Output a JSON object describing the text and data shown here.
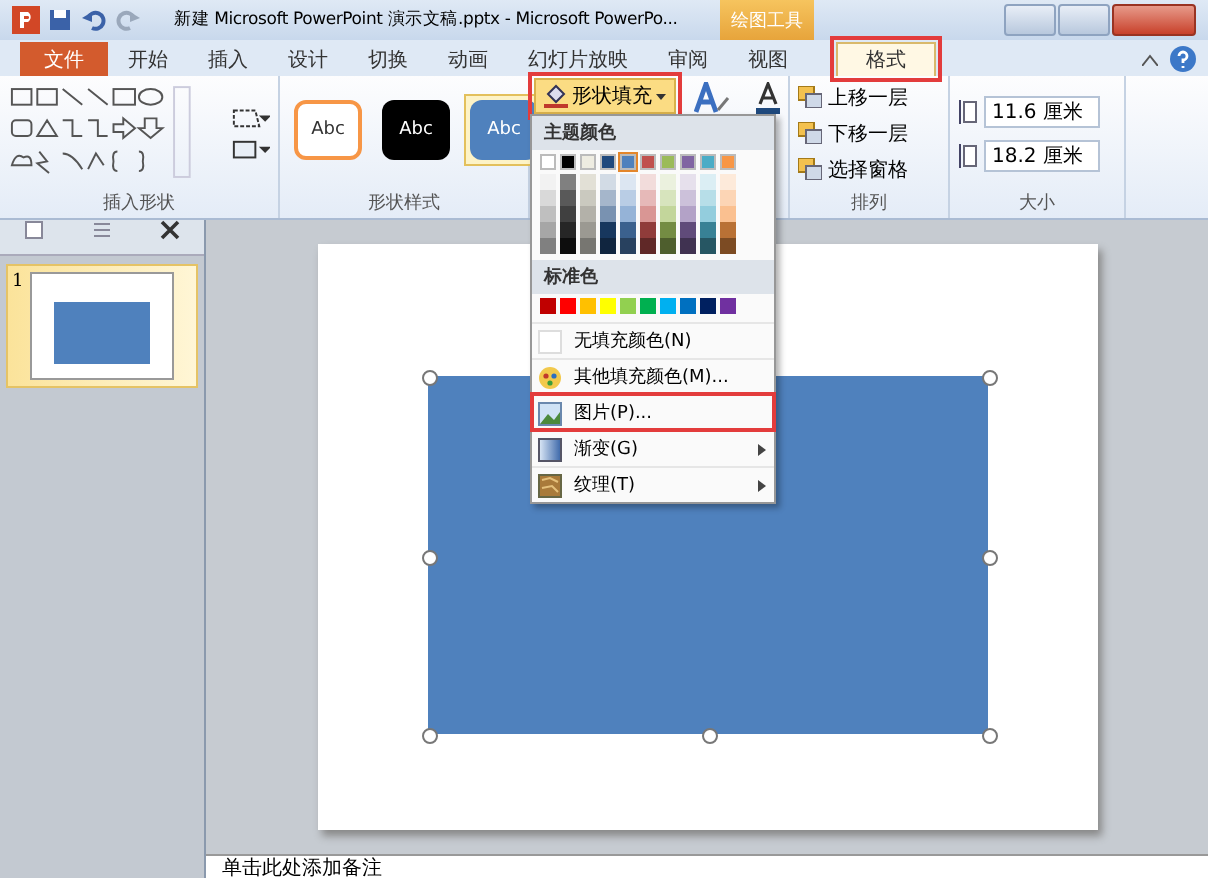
{
  "window": {
    "title": "新建 Microsoft PowerPoint 演示文稿.pptx - Microsoft PowerPo...",
    "context_tab": "绘图工具"
  },
  "tabs": [
    {
      "label": "文件",
      "kind": "file",
      "selected": false,
      "highlighted": false
    },
    {
      "label": "开始",
      "kind": "tab",
      "selected": false,
      "highlighted": false
    },
    {
      "label": "插入",
      "kind": "tab",
      "selected": false,
      "highlighted": false
    },
    {
      "label": "设计",
      "kind": "tab",
      "selected": false,
      "highlighted": false
    },
    {
      "label": "切换",
      "kind": "tab",
      "selected": false,
      "highlighted": false
    },
    {
      "label": "动画",
      "kind": "tab",
      "selected": false,
      "highlighted": false
    },
    {
      "label": "幻灯片放映",
      "kind": "tab",
      "selected": false,
      "highlighted": false
    },
    {
      "label": "审阅",
      "kind": "tab",
      "selected": false,
      "highlighted": false
    },
    {
      "label": "视图",
      "kind": "tab",
      "selected": false,
      "highlighted": false
    },
    {
      "label": "格式",
      "kind": "tab",
      "selected": true,
      "highlighted": true
    }
  ],
  "ribbon": {
    "insert_shapes": {
      "label": "插入形状"
    },
    "shape_styles": {
      "label": "形状样式",
      "styles": [
        {
          "label": "Abc",
          "color": "#f79646",
          "kind": "outline",
          "selected": false
        },
        {
          "label": "Abc",
          "color": "#000000",
          "kind": "filled",
          "selected": false
        },
        {
          "label": "Abc",
          "color": "#4f81bd",
          "kind": "filled",
          "selected": true
        }
      ]
    },
    "shape_fill": {
      "label": "形状填充",
      "highlighted": true
    },
    "arrange": {
      "label": "排列",
      "items": [
        {
          "label": "上移一层"
        },
        {
          "label": "下移一层"
        },
        {
          "label": "选择窗格"
        }
      ]
    },
    "size": {
      "label": "大小",
      "fields": [
        {
          "value": "11.6 厘米"
        },
        {
          "value": "18.2 厘米"
        }
      ]
    }
  },
  "fill_menu": {
    "theme_heading": "主题颜色",
    "theme_colors": [
      {
        "color": "#ffffff",
        "selected": false
      },
      {
        "color": "#000000",
        "selected": false
      },
      {
        "color": "#eeece1",
        "selected": false
      },
      {
        "color": "#1f497d",
        "selected": false
      },
      {
        "color": "#4f81bd",
        "selected": true
      },
      {
        "color": "#c0504d",
        "selected": false
      },
      {
        "color": "#9bbb59",
        "selected": false
      },
      {
        "color": "#8064a2",
        "selected": false
      },
      {
        "color": "#4bacc6",
        "selected": false
      },
      {
        "color": "#f79646",
        "selected": false
      }
    ],
    "standard_heading": "标准色",
    "standard_colors": [
      {
        "color": "#c00000"
      },
      {
        "color": "#ff0000"
      },
      {
        "color": "#ffc000"
      },
      {
        "color": "#ffff00"
      },
      {
        "color": "#92d050"
      },
      {
        "color": "#00b050"
      },
      {
        "color": "#00b0f0"
      },
      {
        "color": "#0070c0"
      },
      {
        "color": "#002060"
      },
      {
        "color": "#7030a0"
      }
    ],
    "items": [
      {
        "label": "无填充颜色(N)",
        "kind": "none",
        "submenu": false,
        "highlighted": false
      },
      {
        "label": "其他填充颜色(M)...",
        "kind": "palette",
        "submenu": false,
        "highlighted": false
      },
      {
        "label": "图片(P)...",
        "kind": "picture",
        "submenu": false,
        "highlighted": true
      },
      {
        "label": "渐变(G)",
        "kind": "gradient",
        "submenu": true,
        "highlighted": false
      },
      {
        "label": "纹理(T)",
        "kind": "texture",
        "submenu": true,
        "highlighted": false
      }
    ]
  },
  "slides_panel": {
    "slides": [
      {
        "number": "1",
        "selected": true
      }
    ]
  },
  "notes": {
    "placeholder": "单击此处添加备注"
  }
}
